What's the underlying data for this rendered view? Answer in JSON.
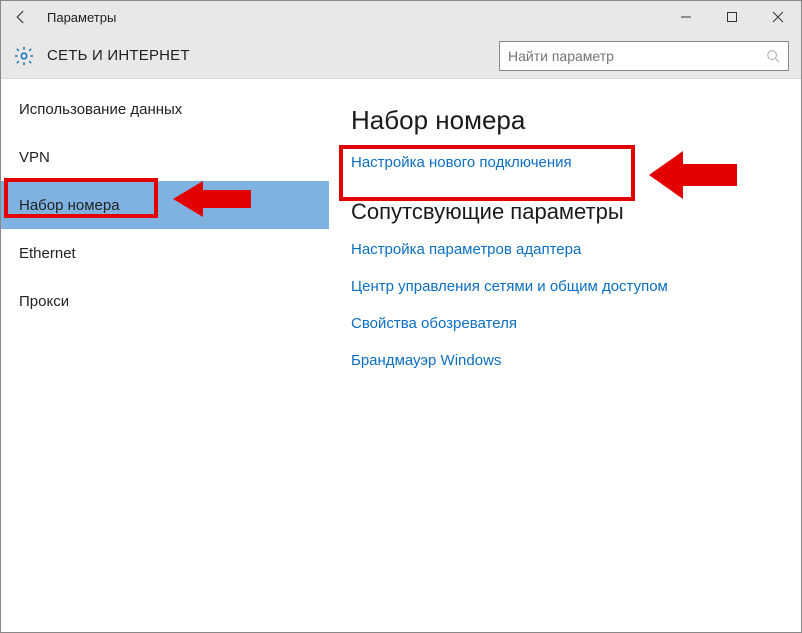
{
  "window": {
    "title": "Параметры"
  },
  "header": {
    "category": "СЕТЬ И ИНТЕРНЕТ"
  },
  "search": {
    "placeholder": "Найти параметр"
  },
  "sidebar": {
    "items": [
      {
        "label": "Использование данных"
      },
      {
        "label": "VPN"
      },
      {
        "label": "Набор номера",
        "active": true
      },
      {
        "label": "Ethernet"
      },
      {
        "label": "Прокси"
      }
    ]
  },
  "content": {
    "heading": "Набор номера",
    "link1": "Настройка нового подключения",
    "related_heading": "Сопутсвующие параметры",
    "links": [
      "Настройка параметров адаптера",
      "Центр управления сетями и общим доступом",
      "Свойства обозревателя",
      "Брандмауэр Windows"
    ]
  }
}
